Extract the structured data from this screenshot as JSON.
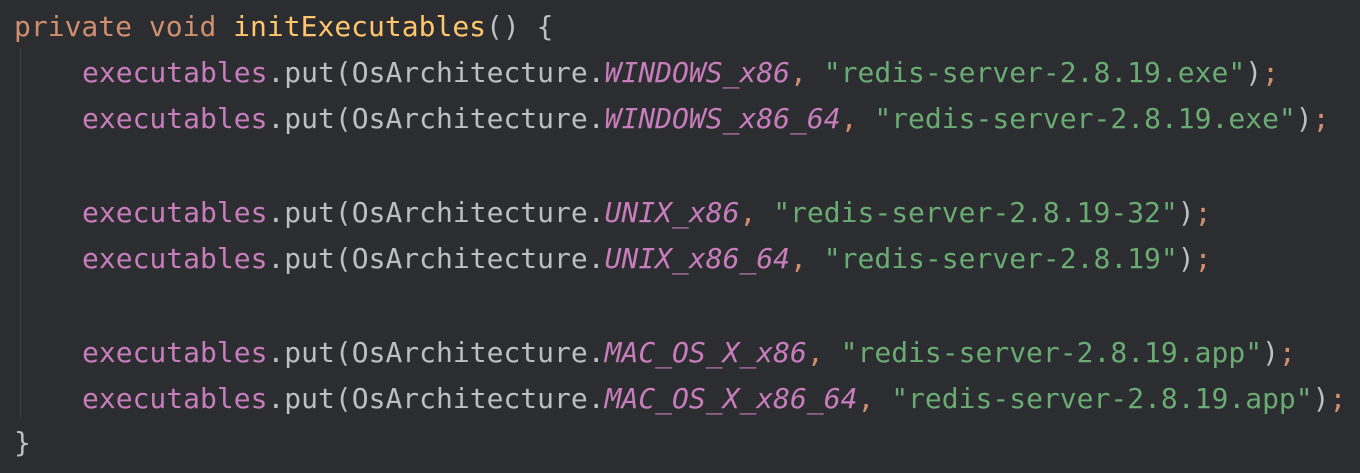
{
  "code": {
    "line1": {
      "kw_private": "private",
      "kw_void": "void",
      "method_name": "initExecutables",
      "parens": "()",
      "open_brace": "{"
    },
    "calls": [
      {
        "receiver": "executables",
        "method": "put",
        "class": "OsArchitecture",
        "constant": "WINDOWS_x86",
        "value": "\"redis-server-2.8.19.exe\""
      },
      {
        "receiver": "executables",
        "method": "put",
        "class": "OsArchitecture",
        "constant": "WINDOWS_x86_64",
        "value": "\"redis-server-2.8.19.exe\""
      },
      {
        "receiver": "executables",
        "method": "put",
        "class": "OsArchitecture",
        "constant": "UNIX_x86",
        "value": "\"redis-server-2.8.19-32\""
      },
      {
        "receiver": "executables",
        "method": "put",
        "class": "OsArchitecture",
        "constant": "UNIX_x86_64",
        "value": "\"redis-server-2.8.19\""
      },
      {
        "receiver": "executables",
        "method": "put",
        "class": "OsArchitecture",
        "constant": "MAC_OS_X_x86",
        "value": "\"redis-server-2.8.19.app\""
      },
      {
        "receiver": "executables",
        "method": "put",
        "class": "OsArchitecture",
        "constant": "MAC_OS_X_x86_64",
        "value": "\"redis-server-2.8.19.app\""
      }
    ],
    "close_brace": "}"
  },
  "colors": {
    "background": "#2b2d30",
    "keyword": "#cf8e6d",
    "method_declaration": "#ffc66d",
    "field": "#c77dbb",
    "string": "#6aab73",
    "default_text": "#bcbec4"
  }
}
